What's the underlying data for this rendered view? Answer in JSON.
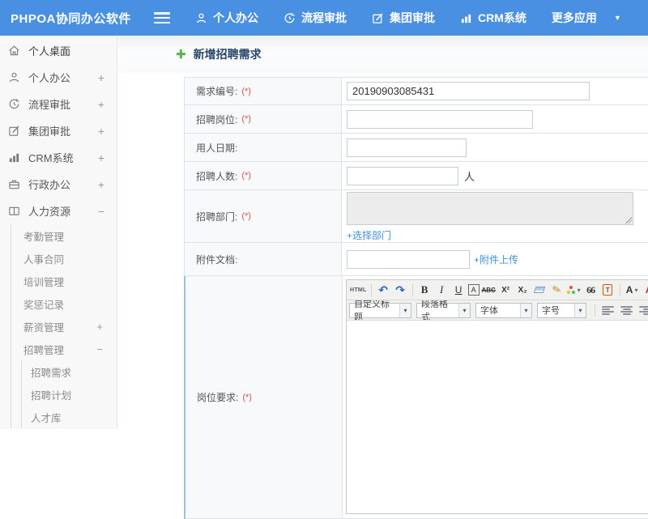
{
  "header": {
    "logo": "PHPOA协同办公软件",
    "nav": [
      {
        "label": "个人办公"
      },
      {
        "label": "流程审批"
      },
      {
        "label": "集团审批"
      },
      {
        "label": "CRM系统"
      },
      {
        "label": "更多应用"
      }
    ]
  },
  "sidebar": {
    "items": [
      {
        "label": "个人桌面",
        "expand": ""
      },
      {
        "label": "个人办公",
        "expand": "+"
      },
      {
        "label": "流程审批",
        "expand": "+"
      },
      {
        "label": "集团审批",
        "expand": "+"
      },
      {
        "label": "CRM系统",
        "expand": "+"
      },
      {
        "label": "行政办公",
        "expand": "+"
      },
      {
        "label": "人力资源",
        "expand": "−"
      }
    ],
    "hr_children": [
      {
        "label": "考勤管理",
        "expand": ""
      },
      {
        "label": "人事合同",
        "expand": ""
      },
      {
        "label": "培训管理",
        "expand": ""
      },
      {
        "label": "奖惩记录",
        "expand": ""
      },
      {
        "label": "薪资管理",
        "expand": "+"
      },
      {
        "label": "招聘管理",
        "expand": "−"
      }
    ],
    "recruit_children": [
      {
        "label": "招聘需求"
      },
      {
        "label": "招聘计划"
      },
      {
        "label": "人才库"
      }
    ]
  },
  "main": {
    "page_title": "新增招聘需求",
    "form": {
      "req_no": {
        "label": "需求编号:",
        "required": "(*)",
        "value": "20190903085431"
      },
      "position": {
        "label": "招聘岗位:",
        "required": "(*)",
        "value": ""
      },
      "date": {
        "label": "用人日期:",
        "required": "",
        "value": ""
      },
      "headcount": {
        "label": "招聘人数:",
        "required": "(*)",
        "value": "",
        "suffix": "人"
      },
      "dept": {
        "label": "招聘部门:",
        "required": "(*)",
        "link": "+选择部门"
      },
      "attach": {
        "label": "附件文档:",
        "required": "",
        "value": "",
        "link": "+附件上传"
      },
      "require": {
        "label": "岗位要求:",
        "required": "(*)"
      }
    },
    "editor": {
      "html_button": "HTML",
      "undo": "↶",
      "redo": "↷",
      "bold": "B",
      "italic": "I",
      "underline": "U",
      "boxed_a": "A",
      "strike": "ABC",
      "superscript": "X²",
      "subscript": "X₂",
      "quote": "66",
      "paste_letter": "T",
      "font_color": "A",
      "caret": "▾",
      "edge_button": "A",
      "dropdowns": {
        "heading": "自定义标题",
        "paragraph": "段落格式",
        "font": "字体",
        "size": "字号"
      }
    }
  },
  "colors": {
    "header_blue": "#4a90e2",
    "link_blue": "#4490d8",
    "required_red": "#e14d4d",
    "title_navy": "#27476b"
  }
}
